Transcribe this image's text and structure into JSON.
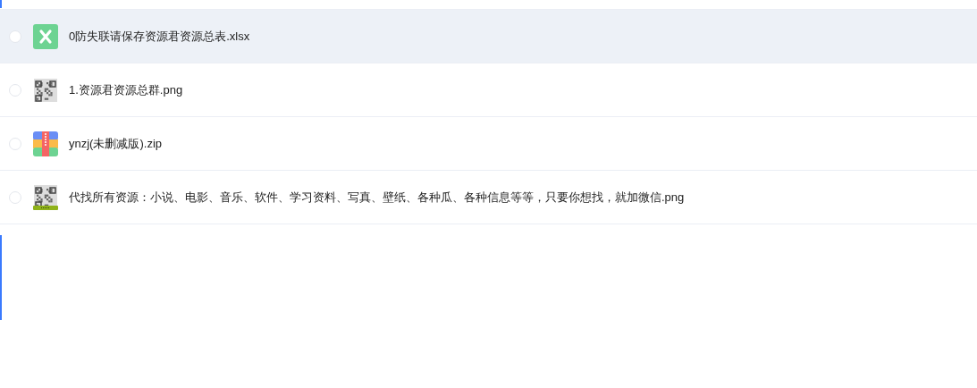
{
  "files": [
    {
      "name": "0防失联请保存资源君资源总表.xlsx",
      "kind": "spreadsheet",
      "checked": false,
      "selected": true
    },
    {
      "name": "1.资源君资源总群.png",
      "kind": "qr",
      "checked": false,
      "selected": false
    },
    {
      "name": "ynzj(未删减版).zip",
      "kind": "archive",
      "checked": false,
      "selected": false
    },
    {
      "name": "代找所有资源：小说、电影、音乐、软件、学习资料、写真、壁纸、各种瓜、各种信息等等，只要你想找，就加微信.png",
      "kind": "qr-banner",
      "checked": false,
      "selected": false
    }
  ]
}
